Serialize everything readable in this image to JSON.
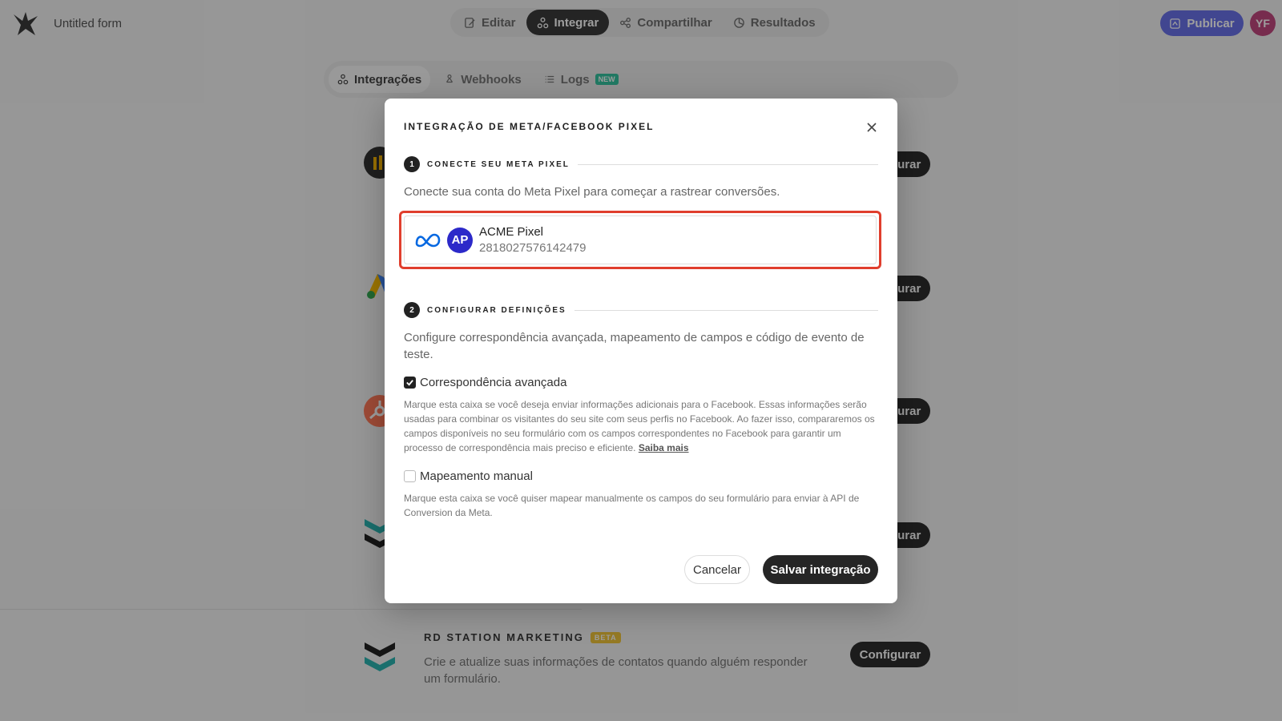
{
  "app": {
    "form_title": "Untitled form",
    "main_tabs": [
      {
        "label": "Editar",
        "icon": "edit-icon",
        "active": false
      },
      {
        "label": "Integrar",
        "icon": "integrate-icon",
        "active": true
      },
      {
        "label": "Compartilhar",
        "icon": "share-icon",
        "active": false
      },
      {
        "label": "Resultados",
        "icon": "results-icon",
        "active": false
      }
    ],
    "publish_label": "Publicar",
    "user_initials": "YF"
  },
  "subnav": {
    "tabs": [
      {
        "label": "Integrações",
        "icon": "integrations-icon",
        "active": true
      },
      {
        "label": "Webhooks",
        "icon": "webhook-icon",
        "active": false
      },
      {
        "label": "Logs",
        "icon": "list-icon",
        "active": false,
        "badge": "NEW"
      }
    ]
  },
  "background_list": {
    "configure_label": "Configurar",
    "rd_station": {
      "title": "RD STATION MARKETING",
      "badge": "BETA",
      "description": "Crie e atualize suas informações de contatos quando alguém responder um formulário."
    }
  },
  "modal": {
    "title": "INTEGRAÇÃO DE META/FACEBOOK PIXEL",
    "step1": {
      "number": "1",
      "label": "CONECTE SEU META PIXEL",
      "description": "Conecte sua conta do Meta Pixel para começar a rastrear conversões."
    },
    "pixel": {
      "initials": "AP",
      "name": "ACME Pixel",
      "id": "2818027576142479"
    },
    "step2": {
      "number": "2",
      "label": "CONFIGURAR DEFINIÇÕES",
      "description": "Configure correspondência avançada, mapeamento de campos e código de evento de teste."
    },
    "advanced_matching": {
      "label": "Correspondência avançada",
      "checked": true,
      "help": "Marque esta caixa se você deseja enviar informações adicionais para o Facebook. Essas informações serão usadas para combinar os visitantes do seu site com seus perfis no Facebook. Ao fazer isso, compararemos os campos disponíveis no seu formulário com os campos correspondentes no Facebook para garantir um processo de correspondência mais preciso e eficiente.",
      "link": "Saiba mais"
    },
    "manual_mapping": {
      "label": "Mapeamento manual",
      "checked": false,
      "help": "Marque esta caixa se você quiser mapear manualmente os campos do seu formulário para enviar à API de Conversion da Meta."
    },
    "cancel_label": "Cancelar",
    "save_label": "Salvar integração"
  },
  "colors": {
    "highlight": "#e03e2d",
    "pixel_avatar": "#2c29c9",
    "publish": "#6a72e8",
    "meta_blue": "#0668e1"
  }
}
